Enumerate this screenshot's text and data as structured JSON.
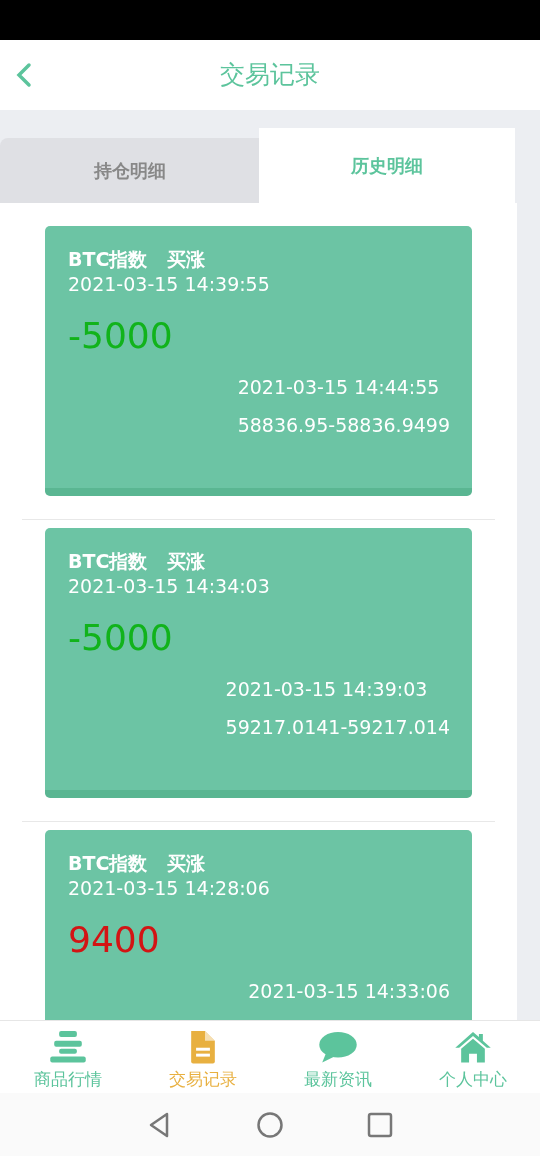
{
  "header": {
    "title": "交易记录"
  },
  "tabs": [
    {
      "label": "持仓明细",
      "selected": false
    },
    {
      "label": "历史明细",
      "selected": true
    }
  ],
  "records": [
    {
      "product": "BTC指数",
      "direction": "买涨",
      "open_time": "2021-03-15 14:39:55",
      "amount": "-5000",
      "kind": "loss",
      "close_time": "2021-03-15 14:44:55",
      "prices": "58836.95-58836.9499"
    },
    {
      "product": "BTC指数",
      "direction": "买涨",
      "open_time": "2021-03-15 14:34:03",
      "amount": "-5000",
      "kind": "loss",
      "close_time": "2021-03-15 14:39:03",
      "prices": "59217.0141-59217.014"
    },
    {
      "product": "BTC指数",
      "direction": "买涨",
      "open_time": "2021-03-15 14:28:06",
      "amount": "9400",
      "kind": "gain",
      "close_time": "2021-03-15 14:33:06"
    }
  ],
  "bottom_nav": [
    {
      "label": "商品行情",
      "kind": "list",
      "selected": false
    },
    {
      "label": "交易记录",
      "kind": "document",
      "selected": true
    },
    {
      "label": "最新资讯",
      "kind": "chat",
      "selected": false
    },
    {
      "label": "个人中心",
      "kind": "home",
      "selected": false
    }
  ]
}
